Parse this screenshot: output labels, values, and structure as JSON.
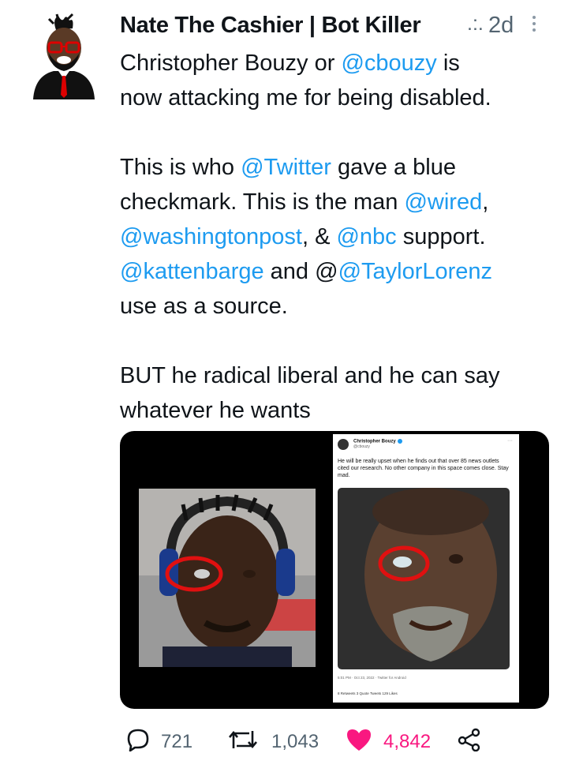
{
  "tweet": {
    "author": "Nate The Cashier | Bot Killer",
    "dots": ".:.",
    "time": "2d",
    "lines": {
      "l1_a": "Christopher Bouzy or ",
      "l1_m": "@cbouzy",
      "l1_b": " is",
      "l2": "now attacking me for being disabled.",
      "l3_a": "This is who ",
      "l3_m": "@Twitter",
      "l3_b": " gave a blue",
      "l4_a": "checkmark. This is the man ",
      "l4_m": "@wired",
      "l4_b": ",",
      "l5_m1": "@washingtonpost",
      "l5_a": ", & ",
      "l5_m2": "@nbc",
      "l5_b": " support.",
      "l6_m1": "@kattenbarge",
      "l6_a": " and @",
      "l6_m2": "@TaylorLorenz",
      "l7": "use as a source.",
      "l8": "BUT he radical liberal and he can say",
      "l9": "whatever he wants"
    }
  },
  "embedded_tweet": {
    "name": "Christopher Bouzy",
    "handle": "@cbouzy",
    "text": "He will be really upset when he finds out that over 85 news outlets cited our research. No other company in this space comes close. Stay mad.",
    "meta": "5:01 PM · Oct 23, 2022 · Twitter for Android",
    "stats": "8 Retweets    3 Quote Tweets    129 Likes"
  },
  "footer": {
    "replies": "721",
    "retweets": "1,043",
    "likes": "4,842"
  },
  "colors": {
    "link": "#1d9bf0",
    "like": "#f91880",
    "muted": "#536471"
  },
  "icons": [
    "reply-icon",
    "retweet-icon",
    "heart-icon",
    "share-icon",
    "more-icon"
  ]
}
